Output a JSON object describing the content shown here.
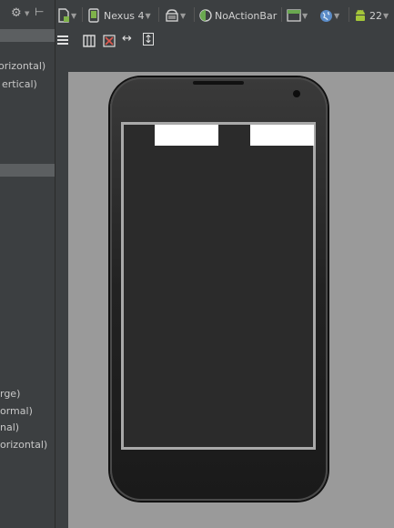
{
  "left_panel": {
    "lines_top": [
      "orizontal)",
      "ertical)"
    ],
    "lines_bottom": [
      "rge)",
      "ormal)",
      "nal)",
      "orizontal)"
    ]
  },
  "toolbar": {
    "device": "Nexus 4",
    "theme": "NoActionBar",
    "api_level": "22"
  },
  "colors": {
    "background": "#3c3f41",
    "canvas": "#9a9a9a",
    "screen": "#2b2b2b",
    "android_green": "#a4c639",
    "theme_green": "#6aa84f"
  }
}
